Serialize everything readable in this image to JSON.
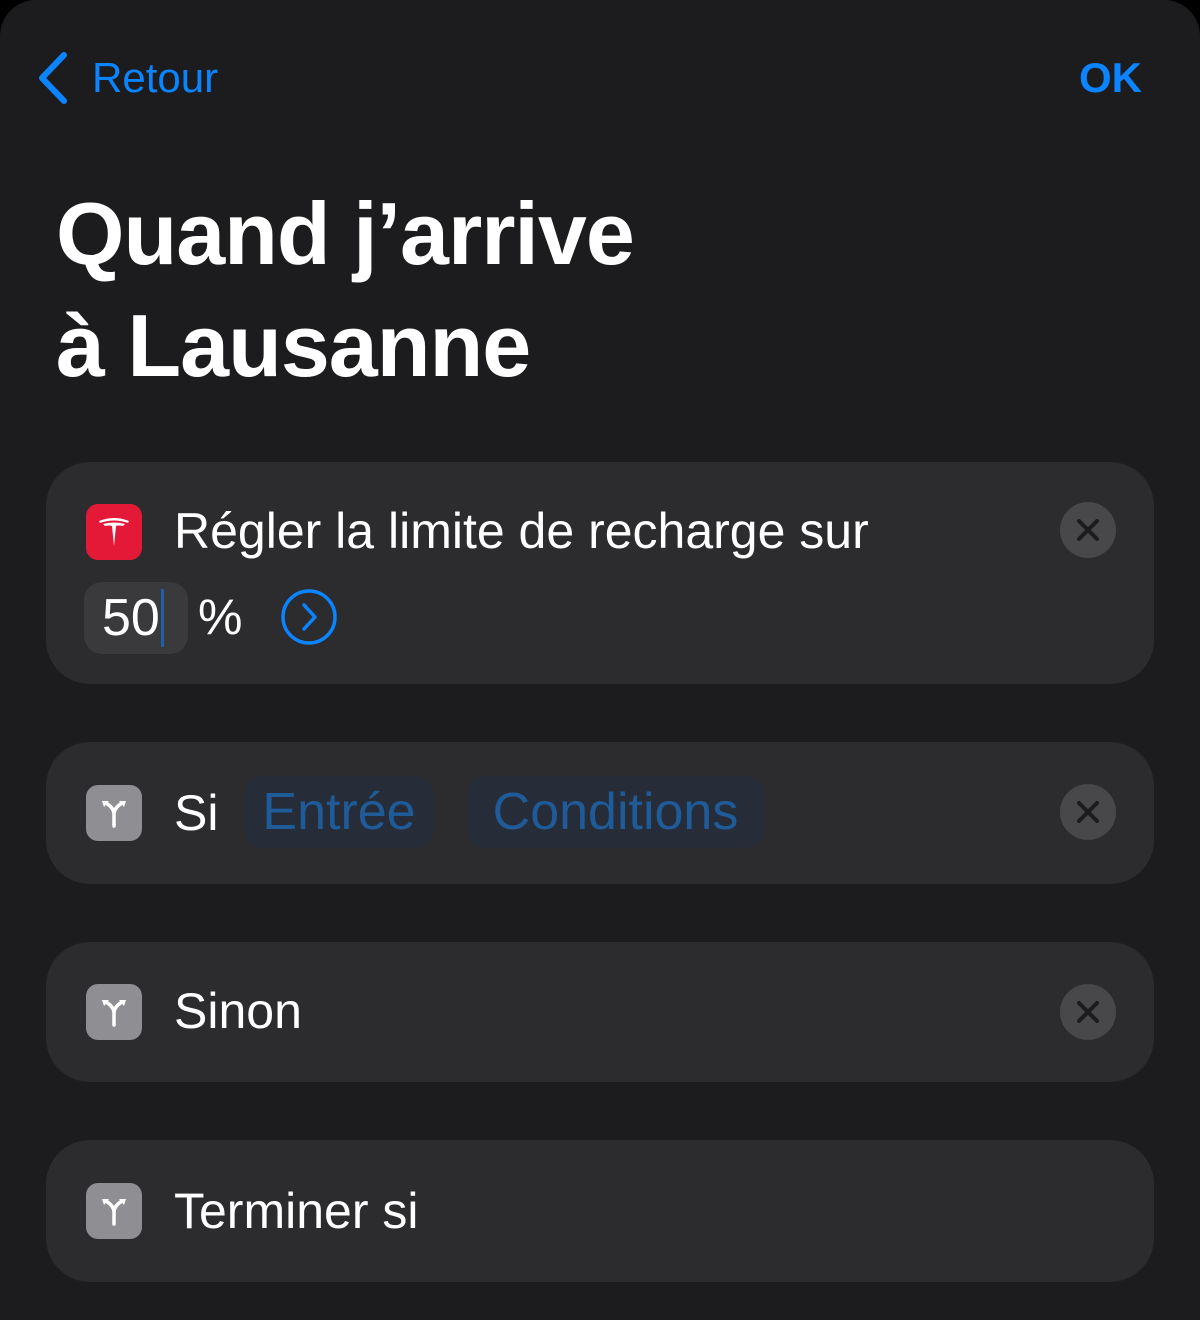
{
  "nav": {
    "back_label": "Retour",
    "done_label": "OK",
    "accent_color": "#0a84ff"
  },
  "title": {
    "line1": "Quand j’arrive",
    "line2": "à Lausanne"
  },
  "actions": [
    {
      "app_icon": "tesla-logo-icon",
      "text": "Régler la limite de recharge sur",
      "value": "50",
      "unit": "%",
      "expand_icon": "chevron-right-circle-icon",
      "remove_icon": "close-icon"
    },
    {
      "app_icon": "branch-icon",
      "text": "Si",
      "tokens": [
        "Entrée",
        "Conditions"
      ],
      "remove_icon": "close-icon"
    },
    {
      "app_icon": "branch-icon",
      "text": "Sinon",
      "remove_icon": "close-icon"
    },
    {
      "app_icon": "branch-icon",
      "text": "Terminer si"
    }
  ]
}
